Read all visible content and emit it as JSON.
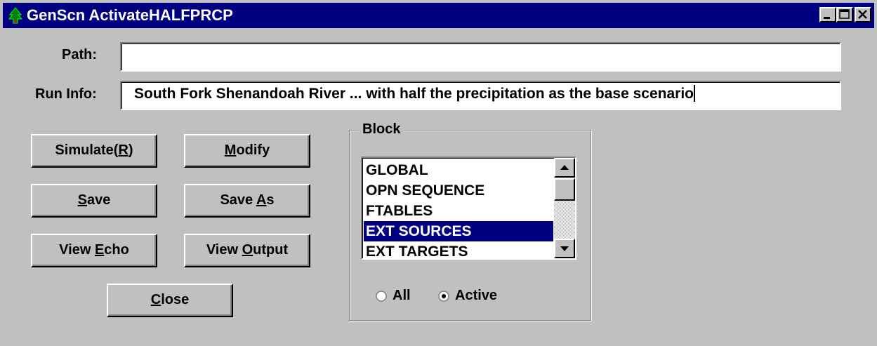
{
  "window": {
    "title": "GenScn ActivateHALFPRCP",
    "app_icon": "tree-icon",
    "controls": {
      "minimize": "minimize-icon",
      "maximize": "maximize-icon",
      "close": "close-icon"
    }
  },
  "form": {
    "path_label": "Path:",
    "path_value": "",
    "runinfo_label": "Run Info:",
    "runinfo_value": "South Fork Shenandoah River ... with half the precipitation as the base scenario"
  },
  "buttons": {
    "simulate": {
      "pre": "Simulate(",
      "key": "R",
      "post": ")"
    },
    "modify": {
      "pre": "",
      "key": "M",
      "post": "odify"
    },
    "save": {
      "pre": "",
      "key": "S",
      "post": "ave"
    },
    "save_as": {
      "pre": "Save ",
      "key": "A",
      "post": "s"
    },
    "view_echo": {
      "pre": "View ",
      "key": "E",
      "post": "cho"
    },
    "view_output": {
      "pre": "View ",
      "key": "O",
      "post": "utput"
    },
    "close": {
      "pre": "",
      "key": "C",
      "post": "lose"
    }
  },
  "block": {
    "title": "Block",
    "items": [
      "GLOBAL",
      "OPN SEQUENCE",
      "FTABLES",
      "EXT SOURCES",
      "EXT TARGETS"
    ],
    "selected_index": 3,
    "scrollbar": {
      "up": "scroll-up-arrow-icon",
      "down": "scroll-down-arrow-icon"
    },
    "filter": {
      "options": [
        "All",
        "Active"
      ],
      "selected": "Active"
    }
  },
  "colors": {
    "titlebar": "#000080",
    "selection": "#000080",
    "face": "#c0c0c0"
  }
}
